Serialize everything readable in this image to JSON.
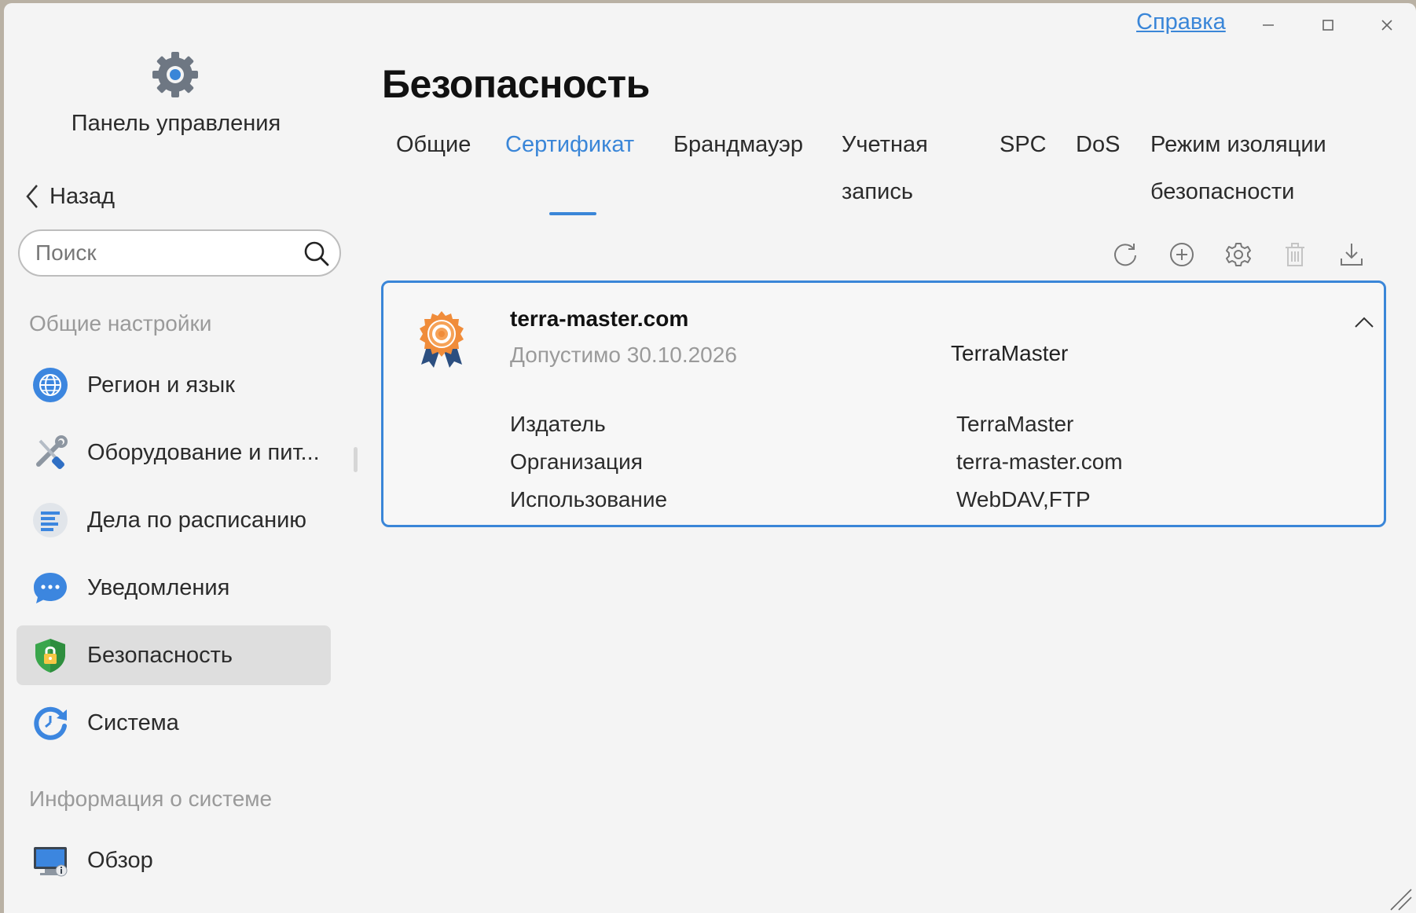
{
  "app": {
    "title": "Панель управления"
  },
  "sidebar": {
    "back_label": "Назад",
    "search_placeholder": "Поиск",
    "section_general": "Общие настройки",
    "items": [
      {
        "label": "Регион и язык",
        "icon": "globe-icon"
      },
      {
        "label": "Оборудование и пит...",
        "icon": "tools-icon"
      },
      {
        "label": "Дела по расписанию",
        "icon": "schedule-icon"
      },
      {
        "label": "Уведомления",
        "icon": "chat-icon"
      },
      {
        "label": "Безопасность",
        "icon": "shield-lock-icon",
        "active": true
      },
      {
        "label": "Система",
        "icon": "system-refresh-icon"
      }
    ],
    "section_info": "Информация о системе",
    "info_items": [
      {
        "label": "Обзор",
        "icon": "monitor-info-icon"
      }
    ]
  },
  "header": {
    "help_label": "Справка",
    "page_title": "Безопасность"
  },
  "tabs": [
    {
      "label": "Общие"
    },
    {
      "label": "Сертификат",
      "active": true
    },
    {
      "label": "Брандмауэр"
    },
    {
      "label_line1": "Учетная",
      "label_line2": "запись"
    },
    {
      "label": "SPC"
    },
    {
      "label": "DoS"
    },
    {
      "label_line1": "Режим изоляции",
      "label_line2": "безопасности"
    }
  ],
  "toolbar": [
    "refresh-icon",
    "add-icon",
    "settings-icon",
    "delete-icon",
    "download-icon"
  ],
  "certificate": {
    "name": "terra-master.com",
    "valid_until": "Допустимо 30.10.2026",
    "issuer_summary": "TerraMaster",
    "details": [
      {
        "label": "Издатель",
        "value": "TerraMaster"
      },
      {
        "label": "Организация",
        "value": "terra-master.com"
      },
      {
        "label": "Использование",
        "value": "WebDAV,FTP"
      }
    ]
  },
  "colors": {
    "accent": "#3a86d8",
    "active_bg": "#dedede",
    "muted_text": "#9a9a9a"
  }
}
